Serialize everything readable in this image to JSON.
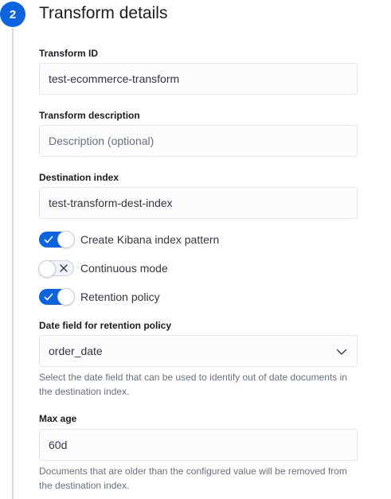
{
  "step": {
    "number": "2",
    "title": "Transform details"
  },
  "fields": {
    "transform_id": {
      "label": "Transform ID",
      "value": "test-ecommerce-transform"
    },
    "transform_description": {
      "label": "Transform description",
      "placeholder": "Description (optional)"
    },
    "destination_index": {
      "label": "Destination index",
      "value": "test-transform-dest-index"
    },
    "date_field": {
      "label": "Date field for retention policy",
      "selected": "order_date",
      "help": "Select the date field that can be used to identify out of date documents in the destination index."
    },
    "max_age": {
      "label": "Max age",
      "value": "60d",
      "help": "Documents that are older than the configured value will be removed from the destination index."
    }
  },
  "switches": {
    "kibana_index_pattern": {
      "label": "Create Kibana index pattern",
      "checked": true
    },
    "continuous_mode": {
      "label": "Continuous mode",
      "checked": false
    },
    "retention_policy": {
      "label": "Retention policy",
      "checked": true
    }
  },
  "colors": {
    "accent": "#0b64dd",
    "border": "#e3e8f2",
    "text": "#343741",
    "subdued": "#69707d"
  },
  "icons": {
    "check": "check-icon",
    "cross": "cross-icon",
    "chevron": "chevron-down-icon"
  }
}
